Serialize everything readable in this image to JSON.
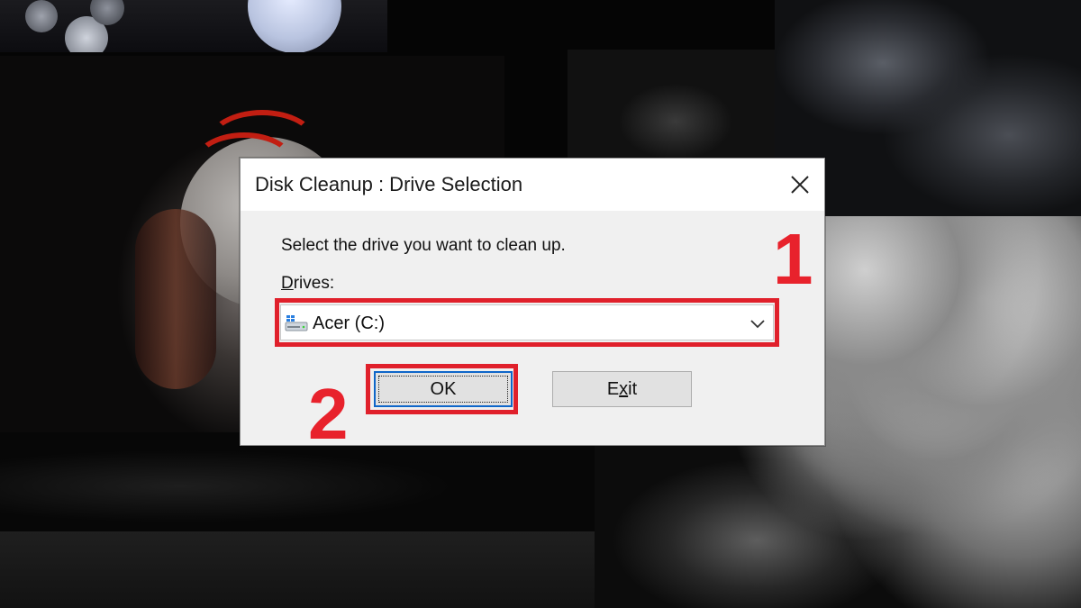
{
  "dialog": {
    "title": "Disk Cleanup : Drive Selection",
    "prompt": "Select the drive you want to clean up.",
    "drives_label_accel": "D",
    "drives_label_rest": "rives:",
    "selected_drive": "Acer (C:)",
    "ok_label": "OK",
    "exit_label_pre": "E",
    "exit_label_accel": "x",
    "exit_label_post": "it"
  },
  "annotations": {
    "step1": "1",
    "step2": "2",
    "highlight_color": "#e0202b"
  },
  "icons": {
    "close": "close-icon",
    "drive": "drive-icon",
    "dropdown": "chevron-down-icon"
  },
  "colors": {
    "focus_border": "#0f66c9",
    "dialog_bg": "#f0f0f0",
    "titlebar_bg": "#ffffff"
  }
}
